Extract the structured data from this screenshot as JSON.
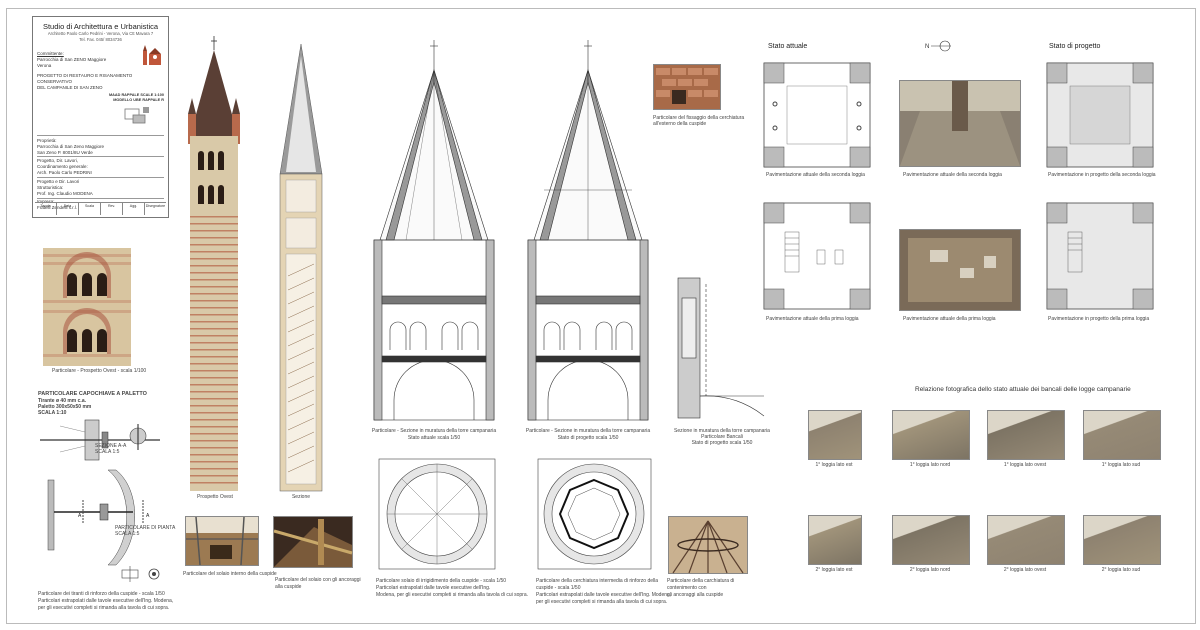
{
  "title_block": {
    "studio": "Studio di Architettura e Urbanistica",
    "address_line1": "Architetto Paolo Carlo Pedrini - Verona, Via Ctt Mavara 7",
    "address_line2": "Tel. Fax. 045/ 8034736",
    "client_label": "Committente:",
    "client_name": "Parrocchia di San ZENO Maggiore",
    "client_city": "Verona",
    "project_line1": "PROGETTO DI RESTAURO E RISANAMENTO CONSERVATIVO",
    "project_line2": "DEL CAMPANILE DI SAN ZENO",
    "sheet_title1": "MAAD RAPPALE SCALE 1:100",
    "sheet_title2": "MODELLO UBE RAPPALE R",
    "section_a_label": "Proprietà:",
    "section_a_text1": "Parrocchia di San Zeno Maggiore",
    "section_a_text2": "San Zeno P. 8001/8U Verde",
    "section_b_label": "Progetto, Dir. Lavori,",
    "section_b_text1": "Coordinamento generale:",
    "section_b_text2": "Arch. Paolo Carlo PEDRINI",
    "section_c_label": "Progetto e Dir. Lavori",
    "section_c_text1": "Strutturistica:",
    "section_c_text2": "Prof. Ing. Claudio MODENA",
    "section_d_label": "Impresa:",
    "section_d_text1": "Fratelli Zendelli s.r.l.",
    "grid": [
      "Tavola",
      "Data",
      "Scala",
      "Rev.",
      "Agg.",
      "Disegnatore"
    ]
  },
  "captions": {
    "facade_detail": "Particolare - Prospetto Ovest - scala 1/100",
    "capochiave_title": "PARTICOLARE CAPOCHIAVE A PALETTO",
    "capochiave_sub1": "Tirante ø 40 mm c.a.",
    "capochiave_sub2": "Paletto 300x50x50 mm",
    "capochiave_sub3": "SCALA 1:10",
    "section_aa": "SEZIONE A-A",
    "section_aa_scale": "SCALA 1:5",
    "pianta_label": "PARTICOLARE DI PIANTA",
    "pianta_scale": "SCALA 1:5",
    "tiranti_caption1": "Particolare dei tiranti di rinforzo della cuspide - scala 1/50",
    "tiranti_caption2": "Particolari estrapolati dalle tavole esecutive dell'Ing. Modena,",
    "tiranti_caption3": "per gli esecutivi completi si rimanda alla tavola di cui sopra.",
    "prospetto_ovest": "Prospetto Ovest",
    "sezione": "Sezione",
    "solaio_interno": "Particolare del solaio interno della cuspide",
    "solaio_cuspide1": "Particolare del solaio con gli ancoraggi",
    "solaio_cuspide2": "alla cuspide",
    "sez_attuale1": "Particolare - Sezione in muratura della torre campanaria",
    "sez_attuale2": "Stato attuale scala 1/50",
    "sez_progetto1": "Particolare - Sezione in muratura della torre campanaria",
    "sez_progetto2": "Stato di progetto scala 1/50",
    "bancali1": "Sezione in muratura della torre campanaria",
    "bancali2": "Particolare Bancali",
    "bancali3": "Stato di progetto scala 1/50",
    "irrigidimento1": "Particolare solaio di irrigidimento della cuspide - scala 1/50",
    "irrigidimento2": "Particolari estrapolati dalle tavole esecutive dell'Ing.",
    "irrigidimento3": "Modena, per gli esecutivi completi si rimanda alla tavola di cui sopra.",
    "cerchiatura1": "Particolare della cerchiatura intermedia di rinforzo della",
    "cerchiatura2": "cuspide - scala 1/50",
    "cerchiatura3": "Particolari estrapolati dalle tavole esecutive dell'Ing. Modena,",
    "cerchiatura4": "per gli esecutivi completi si rimanda alla tavola di cui sopra.",
    "carchiatura_photo1": "Particolare della carchiatura di",
    "carchiatura_photo2": "contenimento con",
    "carchiatura_photo3": "gli ancoraggi alla cuspide",
    "fissaggio1": "Particolare del fissaggio  della cerchiatura",
    "fissaggio2": "all'esterno della cuspide"
  },
  "headings": {
    "stato_attuale": "Stato attuale",
    "stato_progetto": "Stato di progetto",
    "north": "N",
    "relazione": "Relazione fotografica dello stato attuale dei bancali delle logge campanarie"
  },
  "plans": {
    "p1": "Pavimentazione attuale della seconda loggia",
    "p2": "Pavimentazione attuale della seconda loggia",
    "p3": "Pavimentazione in progetto della seconda loggia",
    "p4": "Pavimentazione attuale della prima loggia",
    "p5": "Pavimentazione attuale della prima loggia",
    "p6": "Pavimentazione in progetto della prima loggia"
  },
  "logge": {
    "r1": [
      "1° loggia lato est",
      "1° loggia lato nord",
      "1° loggia lato ovest",
      "1° loggia lato sud"
    ],
    "r2": [
      "2° loggia lato est",
      "2° loggia lato nord",
      "2° loggia lato ovest",
      "2° loggia lato sud"
    ]
  },
  "colors": {
    "brick": "#b86a4c",
    "tufo": "#d9c9a8",
    "roof": "#5a3f35",
    "cusp_grey": "#9a9a9a",
    "line": "#333333"
  }
}
